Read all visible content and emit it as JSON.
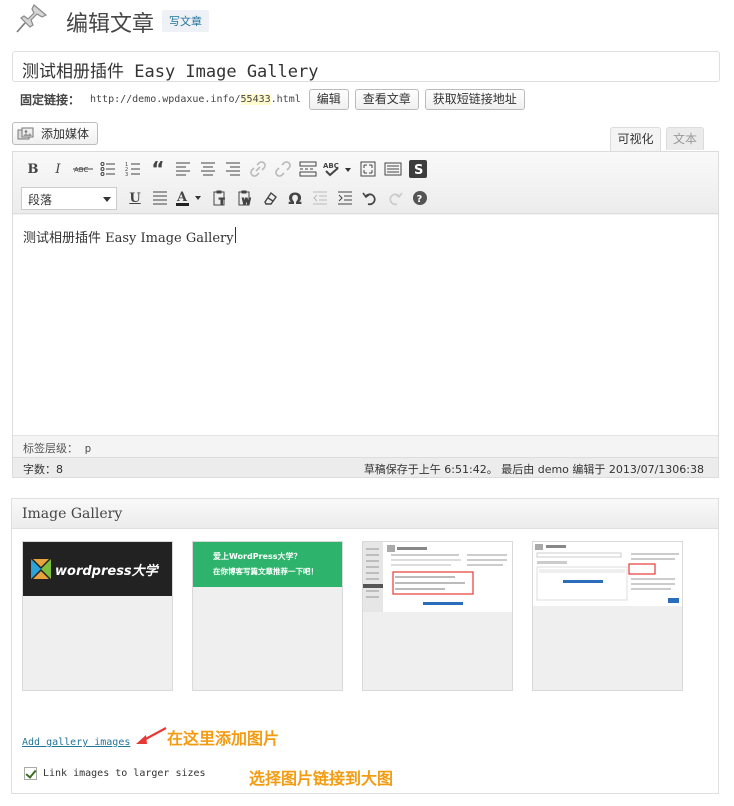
{
  "header": {
    "title": "编辑文章",
    "add_new": "写文章"
  },
  "post": {
    "title": "测试相册插件 Easy Image Gallery"
  },
  "permalink": {
    "label": "固定链接：",
    "base": "http://demo.wpdaxue.info/",
    "slug": "55433",
    "suffix": ".html",
    "edit_button": "编辑",
    "view_button": "查看文章",
    "shortlink_button": "获取短链接地址"
  },
  "editor": {
    "add_media": "添加媒体",
    "tab_visual": "可视化",
    "tab_text": "文本",
    "format_select": "段落",
    "content": "测试相册插件 Easy Image Gallery",
    "path_label": "标签层级：",
    "path_value": "p",
    "word_count": "字数：8",
    "saved_status": "草稿保存于上午 6:51:42。 最后由 demo 编辑于 2013/07/1306:38"
  },
  "gallery": {
    "title": "Image Gallery",
    "thumb1_logo": "wordpress大学",
    "thumb2_line1": "爱上WordPress大学？",
    "thumb2_line2": "在你博客写篇文章推荐一下吧！",
    "add_link": "Add gallery images",
    "annotation_add": "在这里添加图片",
    "link_checkbox_label": "Link images to larger sizes",
    "link_checkbox_checked": true,
    "annotation_link": "选择图片链接到大图"
  },
  "colors": {
    "accent": "#21759b",
    "annotation": "#f39c12",
    "thumb2_bg": "#2db36b",
    "thumb1_bg": "#222222"
  }
}
